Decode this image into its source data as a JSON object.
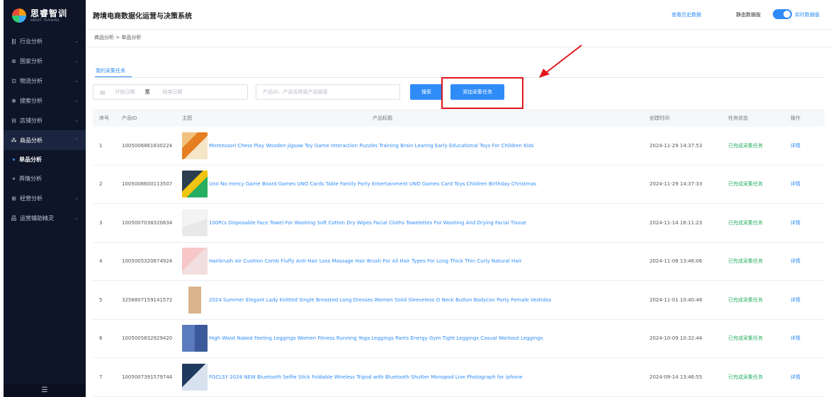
{
  "brand": {
    "name_cn": "思睿智训",
    "name_en": "SMART TRAINING"
  },
  "header": {
    "title": "跨境电商数据化运营与决策系统",
    "history_link": "查看历史数据",
    "static_label": "静态数据版",
    "realtime_label": "实时数据版",
    "realtime_on": true
  },
  "sidebar": {
    "items": [
      {
        "icon": "bars-icon",
        "glyph": "ǁǀ",
        "label": "行业分析"
      },
      {
        "icon": "globe-icon",
        "glyph": "⊛",
        "label": "国家分析"
      },
      {
        "icon": "truck-icon",
        "glyph": "⊡",
        "label": "物流分析"
      },
      {
        "icon": "search-icon",
        "glyph": "⊕",
        "label": "搜索分析"
      },
      {
        "icon": "store-icon",
        "glyph": "⊟",
        "label": "店铺分析"
      },
      {
        "icon": "grid-icon",
        "glyph": "⁂",
        "label": "商品分析"
      }
    ],
    "sub_items": [
      {
        "label": "单品分析",
        "active": true
      },
      {
        "label": "舆情分析",
        "active": false
      }
    ],
    "items_after": [
      {
        "icon": "chart-icon",
        "glyph": "⊞",
        "label": "经营分析"
      },
      {
        "icon": "assistant-icon",
        "glyph": "品",
        "label": "运营辅助精灵"
      }
    ],
    "footer_glyph": "☰"
  },
  "breadcrumb": "商品分析 > 单品分析",
  "tab": "我的采集任务",
  "filters": {
    "start_placeholder": "开始日期",
    "separator": "至",
    "end_placeholder": "结束日期",
    "search_placeholder": "产品ID、产品名称或产品链接",
    "search_button": "搜索",
    "add_button": "添加采集任务"
  },
  "table": {
    "headers": [
      "序号",
      "产品ID",
      "主图",
      "产品标题",
      "创建时间",
      "任务状态",
      "操作"
    ],
    "rows": [
      {
        "idx": "1",
        "id": "1005006861830224",
        "title": "Montessori Chess Play Wooden Jigsaw Toy Game Interaction Puzzles Training Brain Learing Early Educational Toys For Children Kids",
        "time": "2024-11-29 14:37:53",
        "status": "已完成采集任务",
        "op": "详情"
      },
      {
        "idx": "2",
        "id": "1005006600113507",
        "title": "Uno No mercy Game Board Games UNO Cards Table Family Party Entertainment UNO Games Card Toys Children Birthday Christmas",
        "time": "2024-11-29 14:37:33",
        "status": "已完成采集任务",
        "op": "详情"
      },
      {
        "idx": "3",
        "id": "1005007038320634",
        "title": "100Pcs Disposable Face Towel For Washing Soft Cotton Dry Wipes Facial Cloths Towelettes For Washing And Drying Facial Tissue",
        "time": "2024-11-14 16:11:23",
        "status": "已完成采集任务",
        "op": "详情"
      },
      {
        "idx": "4",
        "id": "1005005320874924",
        "title": "Hairbrush Air Cushion Comb Fluffy Anti-Hair Loss Massage Hair Brush For All Hair Types For Long Thick Thin Curly Natural Hair",
        "time": "2024-11-08 13:46:06",
        "status": "已完成采集任务",
        "op": "详情"
      },
      {
        "idx": "5",
        "id": "3256807159141572",
        "title": "2024 Summer Elegant Lady Knitted Single Breasted Long Dresses Women Solid Sleeveless O Neck Button Bodycon Party Female Vestidos",
        "time": "2024-11-01 10:40:48",
        "status": "已完成采集任务",
        "op": "详情"
      },
      {
        "idx": "6",
        "id": "1005005832929420",
        "title": "High Waist Naked Feeling Leggings Women Fitness Running Yoga Leggings Pants Energy Gym Tight Leggings Casual Workout Leggings",
        "time": "2024-10-09 10:32:44",
        "status": "已完成采集任务",
        "op": "详情"
      },
      {
        "idx": "7",
        "id": "1005007391579744",
        "title": "FGCLSY 2024 NEW Bluetooth Selfie Stick Foldable Wireless Tripod with Bluetooth Shutter Monopod Live Photograph for iphone",
        "time": "2024-09-14 13:46:55",
        "status": "已完成采集任务",
        "op": "详情"
      }
    ]
  },
  "colors": {
    "accent": "#2f8cf7",
    "sidebar_bg": "#0e1528",
    "success": "#27ae60",
    "highlight": "#e0161c"
  }
}
